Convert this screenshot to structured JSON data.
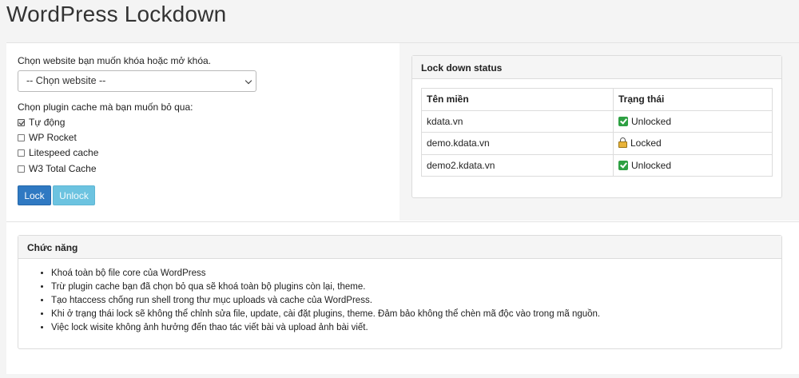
{
  "page": {
    "title": "WordPress Lockdown"
  },
  "form": {
    "site_label": "Chọn website bạn muốn khóa hoặc mở khóa.",
    "site_select_value": "-- Chọn website --",
    "plugin_label": "Chọn plugin cache mà bạn muốn bỏ qua:",
    "plugins": [
      {
        "label": "Tự động",
        "checked": true
      },
      {
        "label": "WP Rocket",
        "checked": false
      },
      {
        "label": "Litespeed cache",
        "checked": false
      },
      {
        "label": "W3 Total Cache",
        "checked": false
      }
    ],
    "lock_label": "Lock",
    "unlock_label": "Unlock"
  },
  "status": {
    "heading": "Lock down status",
    "col_domain": "Tên miền",
    "col_state": "Trạng thái",
    "rows": [
      {
        "domain": "kdata.vn",
        "state": "Unlocked",
        "icon": "check-icon"
      },
      {
        "domain": "demo.kdata.vn",
        "state": "Locked",
        "icon": "lock-icon"
      },
      {
        "domain": "demo2.kdata.vn",
        "state": "Unlocked",
        "icon": "check-icon"
      }
    ]
  },
  "features": {
    "heading": "Chức năng",
    "items": [
      "Khoá toàn bộ file core của WordPress",
      "Trừ plugin cache bạn đã chọn bỏ qua sẽ khoá toàn bộ plugins còn lại, theme.",
      "Tạo htaccess chống run shell trong thư mục uploads và cache của WordPress.",
      "Khi ở trạng thái lock sẽ không thể chỉnh sửa file, update, cài đặt plugins, theme. Đảm bảo không thể chèn mã độc vào trong mã nguồn.",
      "Việc lock wisite không ảnh hưởng đến thao tác viết bài và upload ảnh bài viết."
    ]
  },
  "colors": {
    "lock_button": "#2f79c2",
    "unlock_button": "#6cc3e0",
    "unlocked_icon": "#2ea043",
    "locked_icon": "#e8b33a"
  }
}
